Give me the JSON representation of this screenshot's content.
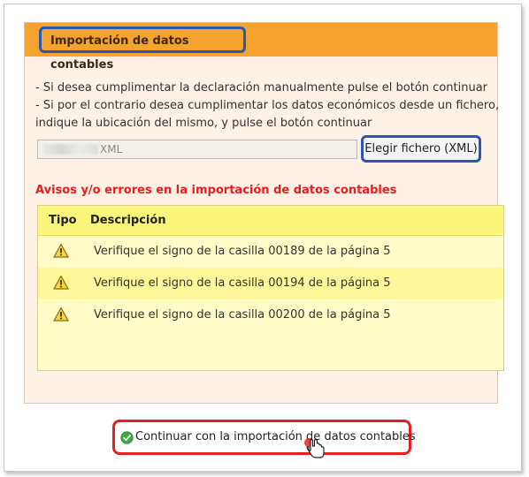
{
  "panel": {
    "title": "Importación de datos contables",
    "instructions": [
      "- Si desea cumplimentar la declaración manualmente pulse el botón continuar",
      "- Si por el contrario desea cumplimentar los datos económicos desde un fichero,",
      "indique la ubicación del mismo, y pulse el botón continuar"
    ],
    "file_input_value": "XML",
    "file_button_label": "Elegir fichero (XML)"
  },
  "warnings": {
    "title": "Avisos y/o errores en la importación de datos contables",
    "columns": [
      "Tipo",
      "Descripción"
    ],
    "rows": [
      {
        "icon": "warning-icon",
        "text": "Verifique el signo de la casilla 00189 de la página 5"
      },
      {
        "icon": "warning-icon",
        "text": "Verifique el signo de la casilla 00194 de la página 5"
      },
      {
        "icon": "warning-icon",
        "text": "Verifique el signo de la casilla 00200 de la página 5"
      }
    ]
  },
  "footer": {
    "continue_label": "Continuar con la importación de datos contables",
    "continue_icon": "check-circle-icon"
  },
  "colors": {
    "header_orange": "#f5a22f",
    "panel_bg": "#fdf0e4",
    "highlight_blue": "#2d55b6",
    "highlight_red": "#e42020",
    "warning_red": "#e81d1d",
    "table_yellow": "#fffcc7",
    "table_header_yellow": "#fbf57c"
  }
}
